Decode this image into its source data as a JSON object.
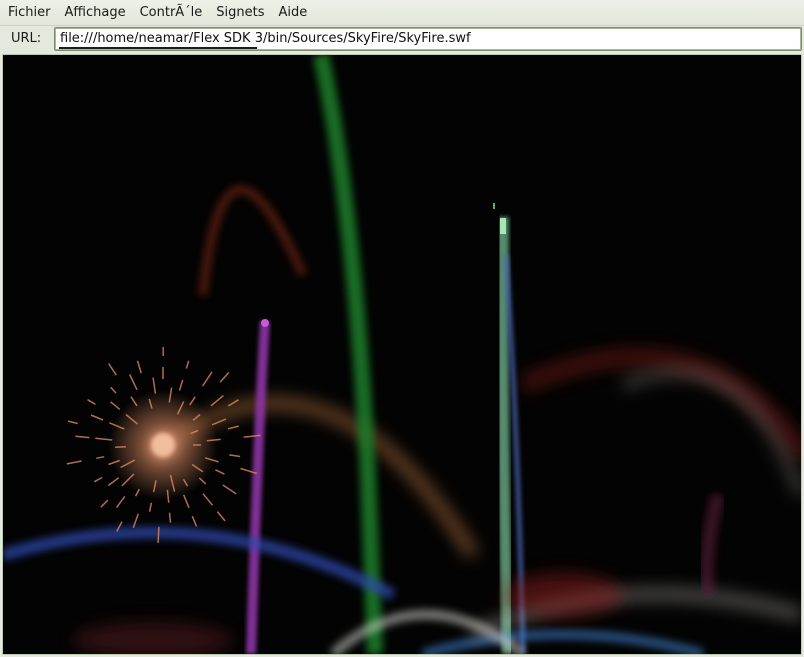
{
  "menubar": {
    "items": [
      {
        "label": "Fichier"
      },
      {
        "label": "Affichage"
      },
      {
        "label": "ContrÃ´le"
      },
      {
        "label": "Signets"
      },
      {
        "label": "Aide"
      }
    ]
  },
  "urlbar": {
    "label": "URL:",
    "value": "file:///home/neamar/Flex SDK 3/bin/Sources/SkyFire/SkyFire.swf"
  },
  "colors": {
    "chrome_bg": "#e3e9dc",
    "stage_bg": "#030303",
    "firework_orange": "#d98a62",
    "firework_green": "#2f9a3a",
    "firework_purple": "#9b3fb0",
    "firework_blue": "#2d48b0",
    "firework_red": "#a0282a"
  }
}
